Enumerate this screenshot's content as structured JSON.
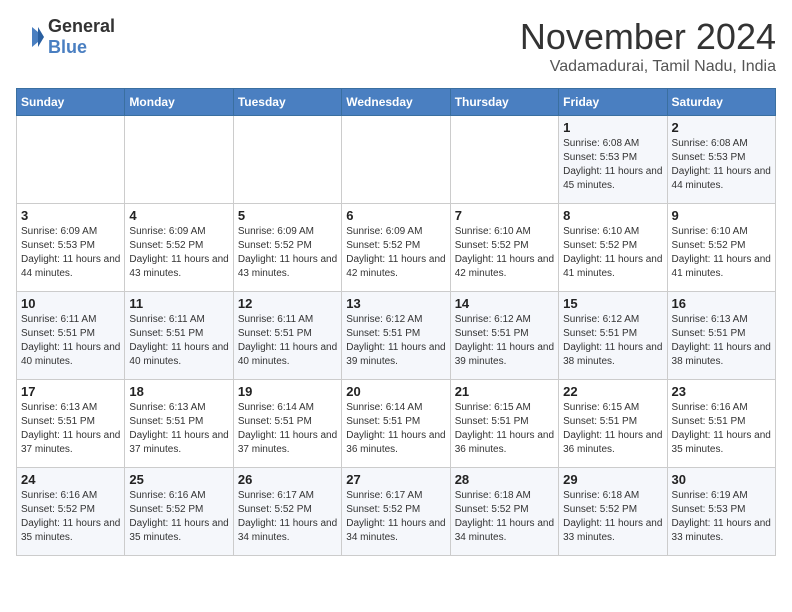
{
  "header": {
    "logo_general": "General",
    "logo_blue": "Blue",
    "month": "November 2024",
    "location": "Vadamadurai, Tamil Nadu, India"
  },
  "weekdays": [
    "Sunday",
    "Monday",
    "Tuesday",
    "Wednesday",
    "Thursday",
    "Friday",
    "Saturday"
  ],
  "weeks": [
    [
      {
        "day": "",
        "info": ""
      },
      {
        "day": "",
        "info": ""
      },
      {
        "day": "",
        "info": ""
      },
      {
        "day": "",
        "info": ""
      },
      {
        "day": "",
        "info": ""
      },
      {
        "day": "1",
        "info": "Sunrise: 6:08 AM\nSunset: 5:53 PM\nDaylight: 11 hours and 45 minutes."
      },
      {
        "day": "2",
        "info": "Sunrise: 6:08 AM\nSunset: 5:53 PM\nDaylight: 11 hours and 44 minutes."
      }
    ],
    [
      {
        "day": "3",
        "info": "Sunrise: 6:09 AM\nSunset: 5:53 PM\nDaylight: 11 hours and 44 minutes."
      },
      {
        "day": "4",
        "info": "Sunrise: 6:09 AM\nSunset: 5:52 PM\nDaylight: 11 hours and 43 minutes."
      },
      {
        "day": "5",
        "info": "Sunrise: 6:09 AM\nSunset: 5:52 PM\nDaylight: 11 hours and 43 minutes."
      },
      {
        "day": "6",
        "info": "Sunrise: 6:09 AM\nSunset: 5:52 PM\nDaylight: 11 hours and 42 minutes."
      },
      {
        "day": "7",
        "info": "Sunrise: 6:10 AM\nSunset: 5:52 PM\nDaylight: 11 hours and 42 minutes."
      },
      {
        "day": "8",
        "info": "Sunrise: 6:10 AM\nSunset: 5:52 PM\nDaylight: 11 hours and 41 minutes."
      },
      {
        "day": "9",
        "info": "Sunrise: 6:10 AM\nSunset: 5:52 PM\nDaylight: 11 hours and 41 minutes."
      }
    ],
    [
      {
        "day": "10",
        "info": "Sunrise: 6:11 AM\nSunset: 5:51 PM\nDaylight: 11 hours and 40 minutes."
      },
      {
        "day": "11",
        "info": "Sunrise: 6:11 AM\nSunset: 5:51 PM\nDaylight: 11 hours and 40 minutes."
      },
      {
        "day": "12",
        "info": "Sunrise: 6:11 AM\nSunset: 5:51 PM\nDaylight: 11 hours and 40 minutes."
      },
      {
        "day": "13",
        "info": "Sunrise: 6:12 AM\nSunset: 5:51 PM\nDaylight: 11 hours and 39 minutes."
      },
      {
        "day": "14",
        "info": "Sunrise: 6:12 AM\nSunset: 5:51 PM\nDaylight: 11 hours and 39 minutes."
      },
      {
        "day": "15",
        "info": "Sunrise: 6:12 AM\nSunset: 5:51 PM\nDaylight: 11 hours and 38 minutes."
      },
      {
        "day": "16",
        "info": "Sunrise: 6:13 AM\nSunset: 5:51 PM\nDaylight: 11 hours and 38 minutes."
      }
    ],
    [
      {
        "day": "17",
        "info": "Sunrise: 6:13 AM\nSunset: 5:51 PM\nDaylight: 11 hours and 37 minutes."
      },
      {
        "day": "18",
        "info": "Sunrise: 6:13 AM\nSunset: 5:51 PM\nDaylight: 11 hours and 37 minutes."
      },
      {
        "day": "19",
        "info": "Sunrise: 6:14 AM\nSunset: 5:51 PM\nDaylight: 11 hours and 37 minutes."
      },
      {
        "day": "20",
        "info": "Sunrise: 6:14 AM\nSunset: 5:51 PM\nDaylight: 11 hours and 36 minutes."
      },
      {
        "day": "21",
        "info": "Sunrise: 6:15 AM\nSunset: 5:51 PM\nDaylight: 11 hours and 36 minutes."
      },
      {
        "day": "22",
        "info": "Sunrise: 6:15 AM\nSunset: 5:51 PM\nDaylight: 11 hours and 36 minutes."
      },
      {
        "day": "23",
        "info": "Sunrise: 6:16 AM\nSunset: 5:51 PM\nDaylight: 11 hours and 35 minutes."
      }
    ],
    [
      {
        "day": "24",
        "info": "Sunrise: 6:16 AM\nSunset: 5:52 PM\nDaylight: 11 hours and 35 minutes."
      },
      {
        "day": "25",
        "info": "Sunrise: 6:16 AM\nSunset: 5:52 PM\nDaylight: 11 hours and 35 minutes."
      },
      {
        "day": "26",
        "info": "Sunrise: 6:17 AM\nSunset: 5:52 PM\nDaylight: 11 hours and 34 minutes."
      },
      {
        "day": "27",
        "info": "Sunrise: 6:17 AM\nSunset: 5:52 PM\nDaylight: 11 hours and 34 minutes."
      },
      {
        "day": "28",
        "info": "Sunrise: 6:18 AM\nSunset: 5:52 PM\nDaylight: 11 hours and 34 minutes."
      },
      {
        "day": "29",
        "info": "Sunrise: 6:18 AM\nSunset: 5:52 PM\nDaylight: 11 hours and 33 minutes."
      },
      {
        "day": "30",
        "info": "Sunrise: 6:19 AM\nSunset: 5:53 PM\nDaylight: 11 hours and 33 minutes."
      }
    ]
  ]
}
